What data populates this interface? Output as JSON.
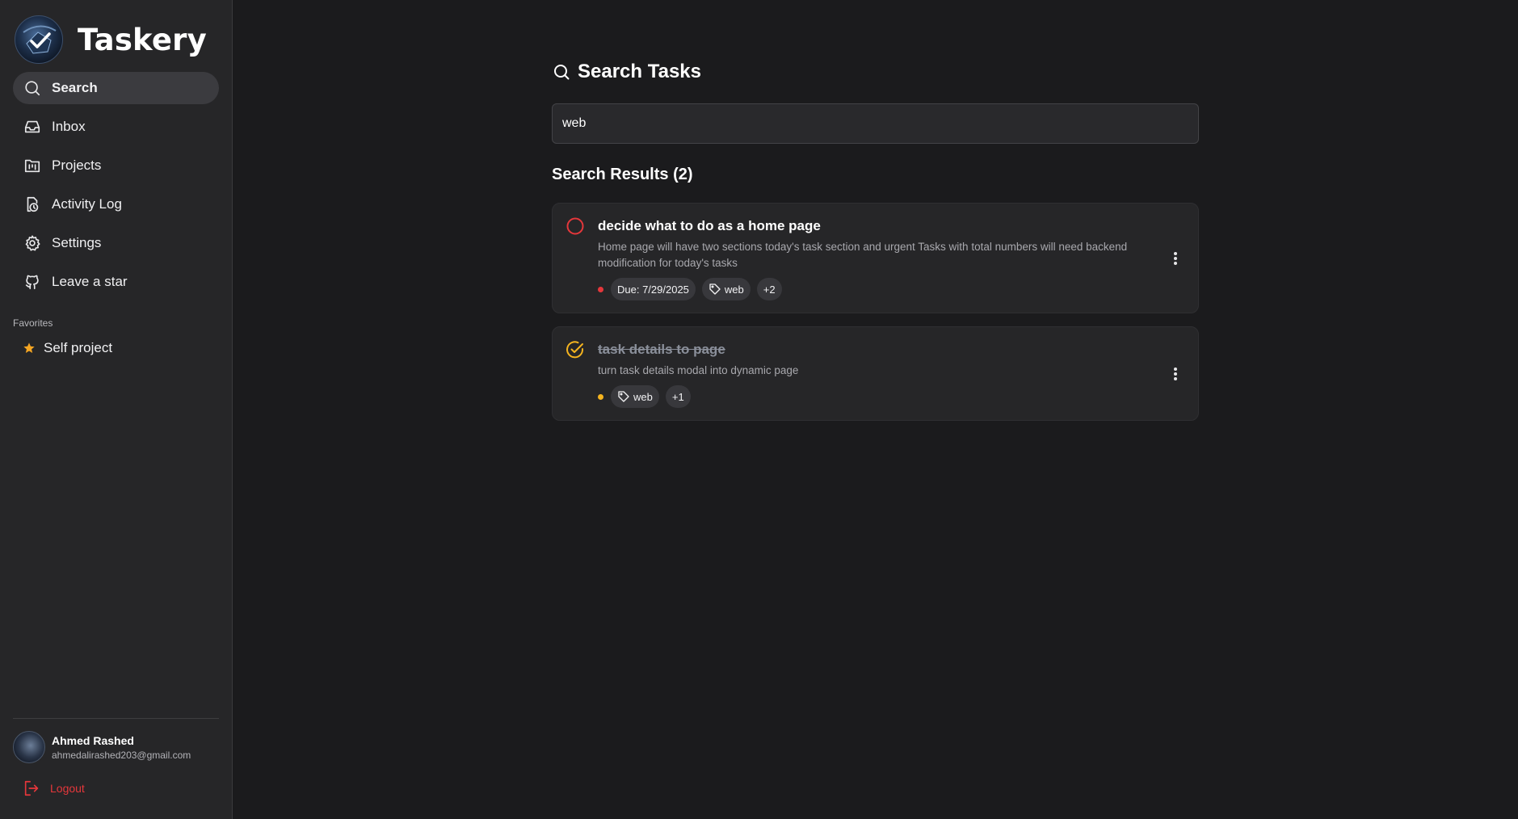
{
  "app": {
    "name": "Taskery",
    "logo_text": "TASKERY"
  },
  "sidebar": {
    "items": [
      {
        "label": "Search",
        "icon": "search-icon",
        "active": true
      },
      {
        "label": "Inbox",
        "icon": "inbox-icon"
      },
      {
        "label": "Projects",
        "icon": "projects-icon"
      },
      {
        "label": "Activity Log",
        "icon": "activity-log-icon"
      },
      {
        "label": "Settings",
        "icon": "gear-icon"
      },
      {
        "label": "Leave a star",
        "icon": "github-icon"
      }
    ],
    "favorites_label": "Favorites",
    "favorites": [
      {
        "label": "Self project",
        "icon": "star-icon",
        "color": "#f5a623"
      }
    ]
  },
  "user": {
    "name": "Ahmed Rashed",
    "email": "ahmedalirashed203@gmail.com"
  },
  "logout": {
    "label": "Logout",
    "color": "#e5373b"
  },
  "main": {
    "title": "Search Tasks",
    "search": {
      "value": "web",
      "placeholder": ""
    },
    "results_title": "Search Results (2)",
    "tasks": [
      {
        "title": "decide what to do as a home page",
        "description": "Home page will have two sections today's task section and urgent Tasks with total numbers will need backend modification for today's tasks",
        "completed": false,
        "priority_color": "#e5373b",
        "due": "Due: 7/29/2025",
        "tag": "web",
        "more_tags": "+2"
      },
      {
        "title": "task details to page",
        "description": "turn task details modal into dynamic page",
        "completed": true,
        "priority_color": "#f5b41f",
        "tag": "web",
        "more_tags": "+1"
      }
    ]
  },
  "colors": {
    "accent": "#e5373b",
    "warning": "#f5b41f",
    "background": "#1b1b1d",
    "sidebar": "#262628"
  }
}
